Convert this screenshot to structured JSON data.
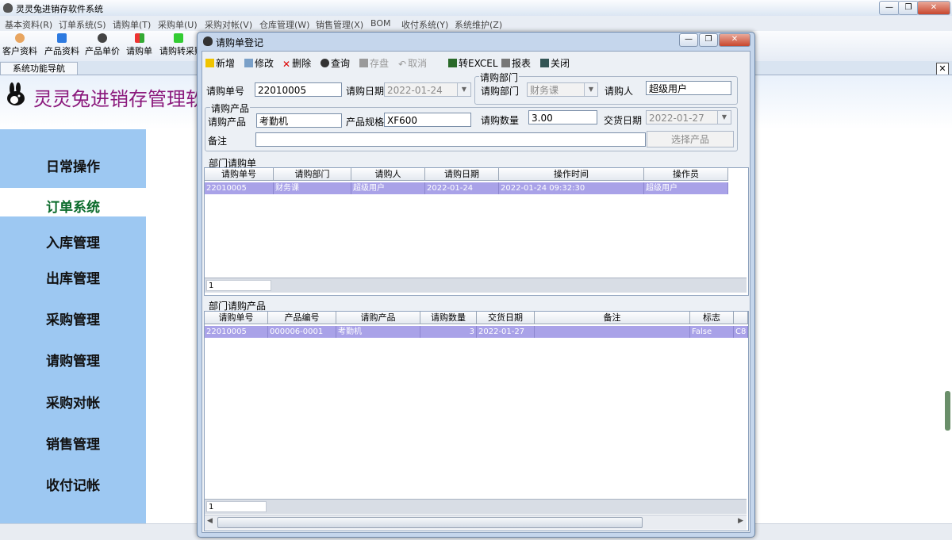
{
  "app": {
    "title": "灵灵兔进销存软件系统"
  },
  "menu": [
    "基本资料(R)",
    "订单系统(S)",
    "请购单(T)",
    "采购单(U)",
    "采购对帐(V)",
    "仓库管理(W)",
    "销售管理(X)",
    "BOM",
    "收付系统(Y)",
    "系统维护(Z)"
  ],
  "toolbar": [
    "客户资料",
    "产品资料",
    "产品单价",
    "请购单",
    "请购转采购"
  ],
  "nav": {
    "tab_label": "系统功能导航",
    "brand": "灵灵兔进销存管理软件",
    "items": [
      "日常操作",
      "订单系统",
      "入库管理",
      "出库管理",
      "采购管理",
      "请购管理",
      "采购对帐",
      "销售管理",
      "收付记帐"
    ],
    "selected": "订单系统"
  },
  "dialog": {
    "title": "请购单登记",
    "tools": {
      "new": "新增",
      "edit": "修改",
      "delete": "删除",
      "query": "查询",
      "save": "存盘",
      "cancel": "取消",
      "excel": "转EXCEL",
      "report": "报表",
      "close": "关闭"
    },
    "form": {
      "req_no_label": "请购单号",
      "req_no": "22010005",
      "req_date_label": "请购日期",
      "req_date": "2022-01-24",
      "dept_group": "请购部门",
      "dept_label": "请购部门",
      "dept": "财务课",
      "requester_label": "请购人",
      "requester": "超级用户",
      "product_group": "请购产品",
      "product_label": "请购产品",
      "product": "考勤机",
      "spec_label": "产品规格",
      "spec": "XF600",
      "qty_label": "请购数量",
      "qty": "3.00",
      "delivery_label": "交货日期",
      "delivery": "2022-01-27",
      "remark_label": "备注",
      "remark": "",
      "select_product": "选择产品"
    },
    "grid1": {
      "title": "部门请购单",
      "columns": [
        "请购单号",
        "请购部门",
        "请购人",
        "请购日期",
        "操作时间",
        "操作员"
      ],
      "rows": [
        [
          "22010005",
          "财务课",
          "超级用户",
          "2022-01-24",
          "2022-01-24 09:32:30",
          "超级用户"
        ]
      ],
      "count": "1"
    },
    "grid2": {
      "title": "部门请购产品",
      "columns": [
        "请购单号",
        "产品编号",
        "请购产品",
        "请购数量",
        "交货日期",
        "备注",
        "标志"
      ],
      "rows": [
        [
          "22010005",
          "000006-0001",
          "考勤机",
          "3",
          "2022-01-27",
          "",
          "False",
          "C8"
        ]
      ],
      "count": "1"
    }
  },
  "colors": {
    "nav_bg": "#9dc8f2",
    "brand": "#8b1a7d",
    "row_selected": "#a9a2e8"
  }
}
